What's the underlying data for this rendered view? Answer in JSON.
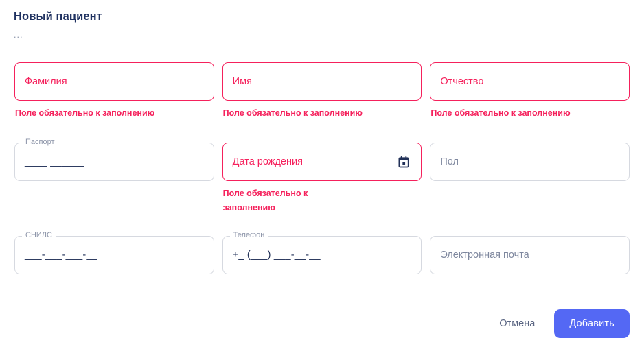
{
  "dialog": {
    "title": "Новый пациент",
    "subtitle": "..."
  },
  "colors": {
    "error": "#f5215c",
    "primary": "#5468f4",
    "title": "#1f3160",
    "border": "#d6d9e0",
    "label": "#8d95a9",
    "placeholder": "#7e879e",
    "value": "#223158"
  },
  "messages": {
    "required": "Поле обязательно к заполнению"
  },
  "form": {
    "rows": [
      {
        "fields": [
          {
            "name": "last-name",
            "placeholder": "Фамилия",
            "value": "",
            "error": "Поле обязательно к заполнению"
          },
          {
            "name": "first-name",
            "placeholder": "Имя",
            "value": "",
            "error": "Поле обязательно к заполнению"
          },
          {
            "name": "middle-name",
            "placeholder": "Отчество",
            "value": "",
            "error": "Поле обязательно к заполнению"
          }
        ]
      },
      {
        "fields": [
          {
            "name": "passport",
            "label": "Паспорт",
            "value": "____ ______",
            "error": ""
          },
          {
            "name": "birth-date",
            "placeholder": "Дата рождения",
            "value": "",
            "icon": "calendar-icon",
            "error": "Поле обязательно к заполнению"
          },
          {
            "name": "gender",
            "placeholder": "Пол",
            "value": "",
            "error": ""
          }
        ]
      },
      {
        "fields": [
          {
            "name": "snils",
            "label": "СНИЛС",
            "value": "___-___-___-__",
            "error": ""
          },
          {
            "name": "phone",
            "label": "Телефон",
            "value": "+_ (___) ___-__-__",
            "error": ""
          },
          {
            "name": "email",
            "placeholder": "Электронная почта",
            "value": "",
            "error": ""
          }
        ]
      }
    ]
  },
  "footer": {
    "cancel_label": "Отмена",
    "submit_label": "Добавить"
  }
}
